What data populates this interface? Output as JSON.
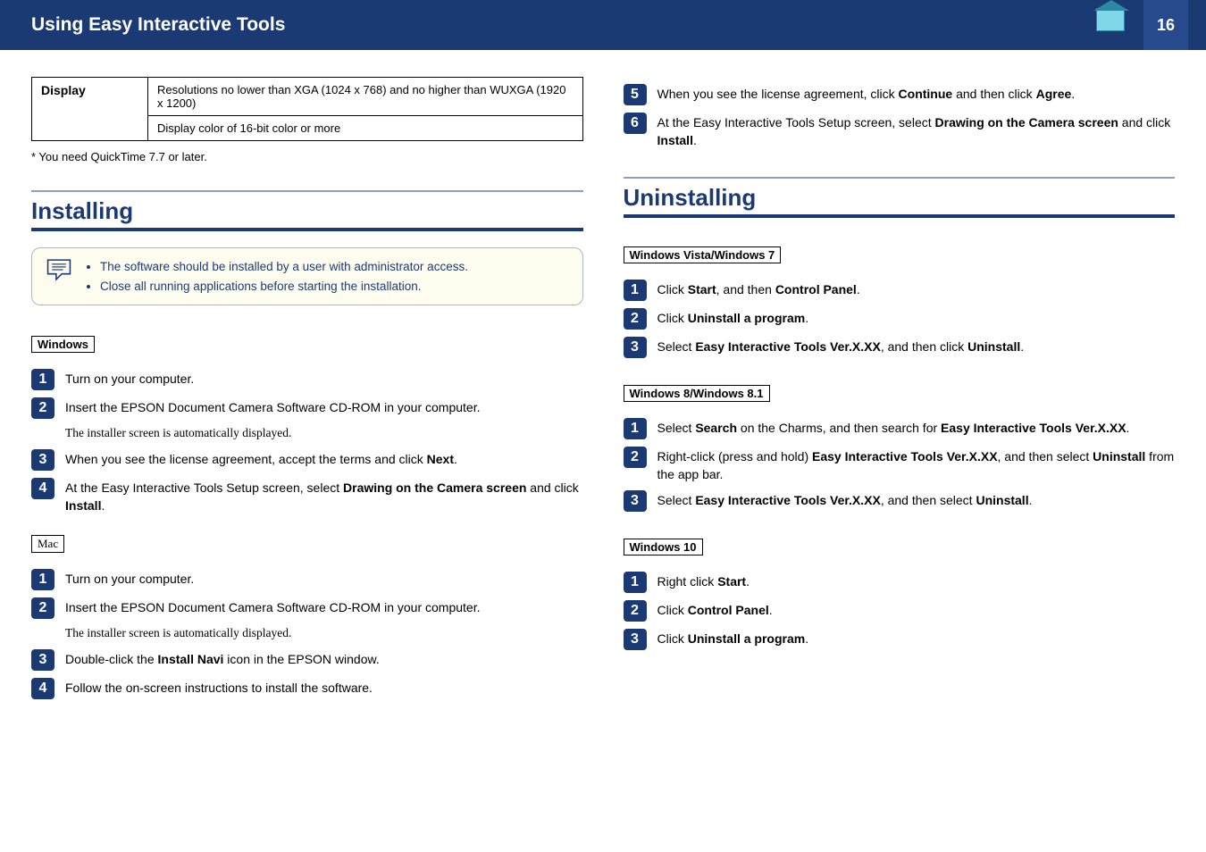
{
  "header": {
    "title": "Using Easy Interactive Tools",
    "page": "16",
    "top_label": "TOP"
  },
  "table": {
    "label": "Display",
    "line1": "Resolutions no lower than XGA (1024 x 768) and no higher than WUXGA (1920 x 1200)",
    "line2": "Display color of 16-bit color or more"
  },
  "footnote": "*    You need QuickTime 7.7 or later.",
  "installing": {
    "heading": "Installing",
    "note1": "The software should be installed by a user with administrator access.",
    "note2": "Close all running applications before starting the installation.",
    "windows_label": "Windows",
    "win_steps": {
      "s1": "Turn on your computer.",
      "s2": "Insert the EPSON Document Camera Software CD-ROM in your computer.",
      "s2_sub": "The installer screen is automatically displayed.",
      "s3_a": "When you see the license agreement, accept the terms and click ",
      "s3_b": "Next",
      "s3_c": ".",
      "s4_a": "At the Easy Interactive Tools Setup screen, select ",
      "s4_b": "Drawing on the Camera screen",
      "s4_c": " and click ",
      "s4_d": "Install",
      "s4_e": "."
    },
    "mac_label": "Mac",
    "mac_steps": {
      "s1": "Turn on your computer.",
      "s2": "Insert the EPSON Document Camera Software CD-ROM in your computer.",
      "s2_sub": "The installer screen is automatically displayed.",
      "s3_a": "Double-click the ",
      "s3_b": "Install Navi",
      "s3_c": " icon in the EPSON window.",
      "s4": "Follow the on-screen instructions to install the software."
    }
  },
  "col2_top": {
    "s5_a": "When you see the license agreement, click ",
    "s5_b": "Continue",
    "s5_c": " and then click ",
    "s5_d": "Agree",
    "s5_e": ".",
    "s6_a": "At the Easy Interactive Tools Setup screen, select ",
    "s6_b": "Drawing on the Camera screen",
    "s6_c": " and click ",
    "s6_d": "Install",
    "s6_e": "."
  },
  "uninstalling": {
    "heading": "Uninstalling",
    "vista_label": "Windows Vista/Windows 7",
    "vista": {
      "s1_a": "Click ",
      "s1_b": "Start",
      "s1_c": ", and then ",
      "s1_d": "Control Panel",
      "s1_e": ".",
      "s2_a": "Click ",
      "s2_b": "Uninstall a program",
      "s2_c": ".",
      "s3_a": "Select ",
      "s3_b": "Easy Interactive Tools Ver.X.XX",
      "s3_c": ", and then click ",
      "s3_d": "Uninstall",
      "s3_e": "."
    },
    "win8_label": "Windows 8/Windows 8.1",
    "win8": {
      "s1_a": "Select ",
      "s1_b": "Search",
      "s1_c": " on the Charms, and then search for ",
      "s1_d": "Easy Interactive Tools Ver.X.XX",
      "s1_e": ".",
      "s2_a": "Right-click (press and hold) ",
      "s2_b": "Easy Interactive Tools Ver.X.XX",
      "s2_c": ", and then select ",
      "s2_d": "Uninstall",
      "s2_e": " from the app bar.",
      "s3_a": "Select ",
      "s3_b": "Easy Interactive Tools Ver.X.XX",
      "s3_c": ", and then select ",
      "s3_d": "Uninstall",
      "s3_e": "."
    },
    "win10_label": "Windows 10",
    "win10": {
      "s1_a": "Right click ",
      "s1_b": "Start",
      "s1_c": ".",
      "s2_a": "Click ",
      "s2_b": "Control Panel",
      "s2_c": ".",
      "s3_a": "Click ",
      "s3_b": "Uninstall a program",
      "s3_c": "."
    }
  },
  "nums": {
    "n1": "1",
    "n2": "2",
    "n3": "3",
    "n4": "4",
    "n5": "5",
    "n6": "6"
  }
}
